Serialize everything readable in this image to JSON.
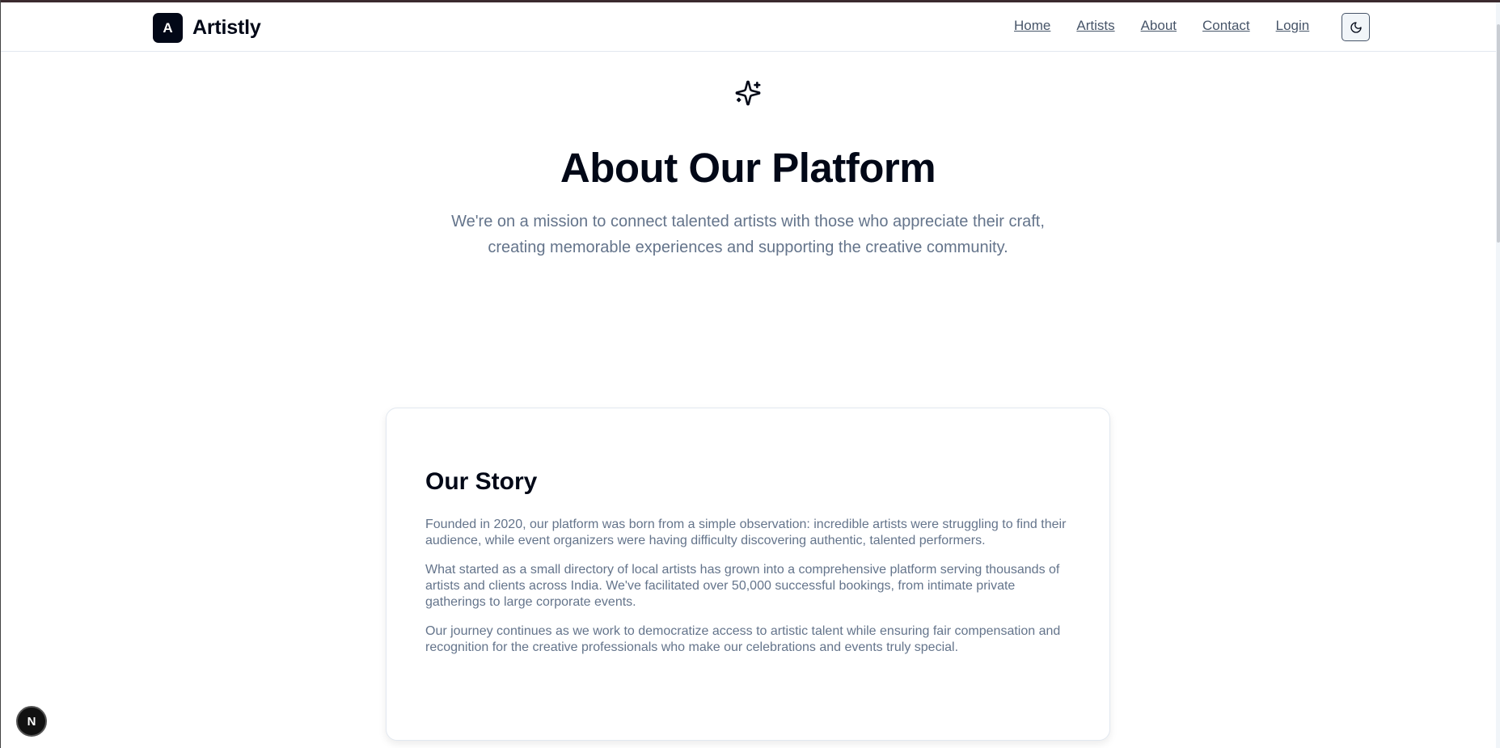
{
  "brand": {
    "logo_letter": "A",
    "name": "Artistly"
  },
  "nav": {
    "items": [
      "Home",
      "Artists",
      "About",
      "Contact",
      "Login"
    ]
  },
  "theme_toggle": {
    "icon": "moon-icon"
  },
  "hero": {
    "icon": "sparkles-icon",
    "title": "About Our Platform",
    "subtitle": "We're on a mission to connect talented artists with those who appreciate their craft, creating memorable experiences and supporting the creative community."
  },
  "story": {
    "title": "Our Story",
    "paragraphs": [
      "Founded in 2020, our platform was born from a simple observation: incredible artists were struggling to find their audience, while event organizers were having difficulty discovering authentic, talented performers.",
      "What started as a small directory of local artists has grown into a comprehensive platform serving thousands of artists and clients across India. We've facilitated over 50,000 successful bookings, from intimate private gatherings to large corporate events.",
      "Our journey continues as we work to democratize access to artistic talent while ensuring fair compensation and recognition for the creative professionals who make our celebrations and events truly special."
    ]
  },
  "dev_badge": {
    "letter": "N"
  },
  "colors": {
    "primary": "#020817",
    "muted_text": "#64748b",
    "border": "#e2e8f0"
  }
}
